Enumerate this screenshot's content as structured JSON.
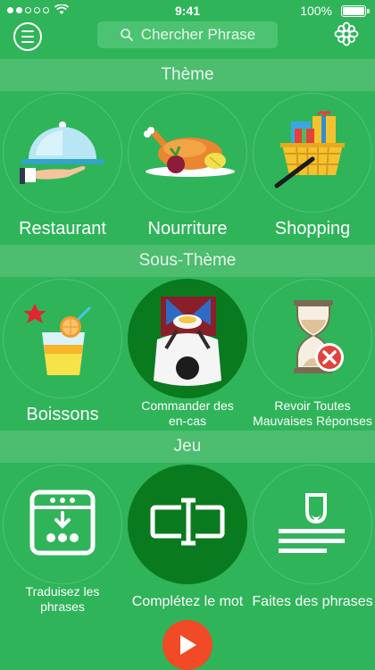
{
  "status_bar": {
    "time": "9:41",
    "battery": "100%"
  },
  "header": {
    "search_placeholder": "Chercher Phrase",
    "menu_icon": "menu-icon",
    "settings_icon": "flower-gear-icon"
  },
  "sections": {
    "theme": "Thème",
    "subtheme": "Sous-Thème",
    "game": "Jeu"
  },
  "themes": [
    {
      "label": "Restaurant",
      "icon": "cloche-icon"
    },
    {
      "label": "Nourriture",
      "icon": "roast-chicken-icon"
    },
    {
      "label": "Shopping",
      "icon": "shopping-basket-icon"
    }
  ],
  "subthemes": [
    {
      "label": "Boissons",
      "icon": "cocktail-icon"
    },
    {
      "label_line1": "Commander des",
      "label_line2": "en-cas",
      "icon": "waiter-icon",
      "selected": true
    },
    {
      "label_line1": "Revoir Toutes",
      "label_line2": "Mauvaises Réponses",
      "icon": "hourglass-icon"
    }
  ],
  "games": [
    {
      "label_line1": "Traduisez les",
      "label_line2": "phrases",
      "icon": "translate-grid-icon"
    },
    {
      "label": "Complétez le mot",
      "icon": "fill-word-icon",
      "selected": true
    },
    {
      "label": "Faites des phrases",
      "icon": "build-sentence-icon"
    }
  ],
  "play_button": {
    "icon": "play-icon"
  },
  "colors": {
    "background": "#2fb45a",
    "header_band": "#4dbd6f",
    "selected": "#0a7a1f",
    "play": "#f04a26"
  }
}
